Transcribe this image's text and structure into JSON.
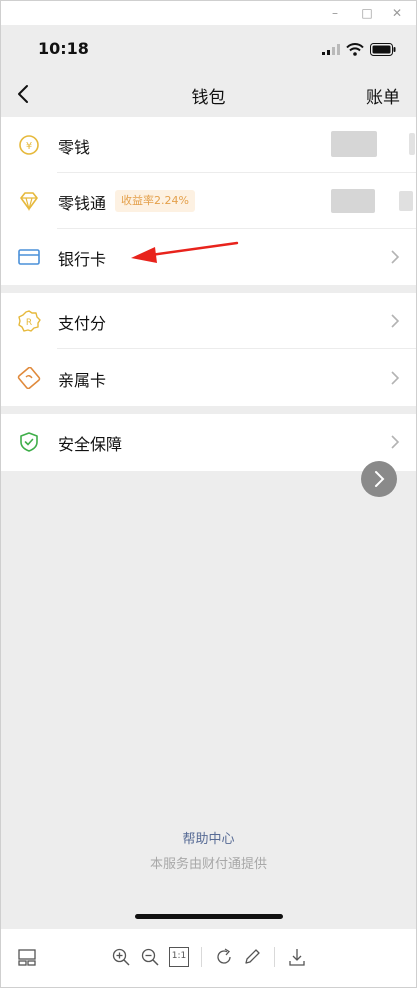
{
  "window": {
    "minimize_glyph": "–",
    "maximize_glyph": "□",
    "close_glyph": "✕"
  },
  "status_bar": {
    "time": "10:18",
    "icons": [
      "cellular-signal-icon",
      "wifi-icon",
      "battery-icon"
    ]
  },
  "nav": {
    "back_icon": "back-chevron-icon",
    "title": "钱包",
    "bill_label": "账单"
  },
  "groups": [
    {
      "items": [
        {
          "label": "零钱",
          "icon": "yuan-coin-icon",
          "value_hidden": true
        },
        {
          "label": "零钱通",
          "icon": "diamond-icon",
          "badge": "收益率2.24%",
          "value_hidden": true
        },
        {
          "label": "银行卡",
          "icon": "bank-card-icon"
        }
      ]
    },
    {
      "items": [
        {
          "label": "支付分",
          "icon": "credit-score-icon"
        },
        {
          "label": "亲属卡",
          "icon": "family-card-icon"
        }
      ]
    },
    {
      "items": [
        {
          "label": "安全保障",
          "icon": "security-shield-icon"
        }
      ]
    }
  ],
  "footer": {
    "help_link": "帮助中心",
    "provider_text": "本服务由财付通提供"
  },
  "viewer_toolbar": {
    "buttons": [
      "thumbnail-icon",
      "zoom-in-icon",
      "zoom-out-icon",
      "actual-size-icon",
      "rotate-icon",
      "edit-pen-icon",
      "download-icon"
    ],
    "actual_size_label": "1:1"
  },
  "colors": {
    "background": "#ededed",
    "card": "#ffffff",
    "link": "#576b95",
    "badge_text": "#e4a04b",
    "badge_bg": "#fdf1e2",
    "annotation_arrow": "#e8231c",
    "yuan_icon": "#e6b93c",
    "card_icon": "#4a90d9",
    "shield_icon": "#3fae4a",
    "family_icon": "#e08a3c"
  }
}
